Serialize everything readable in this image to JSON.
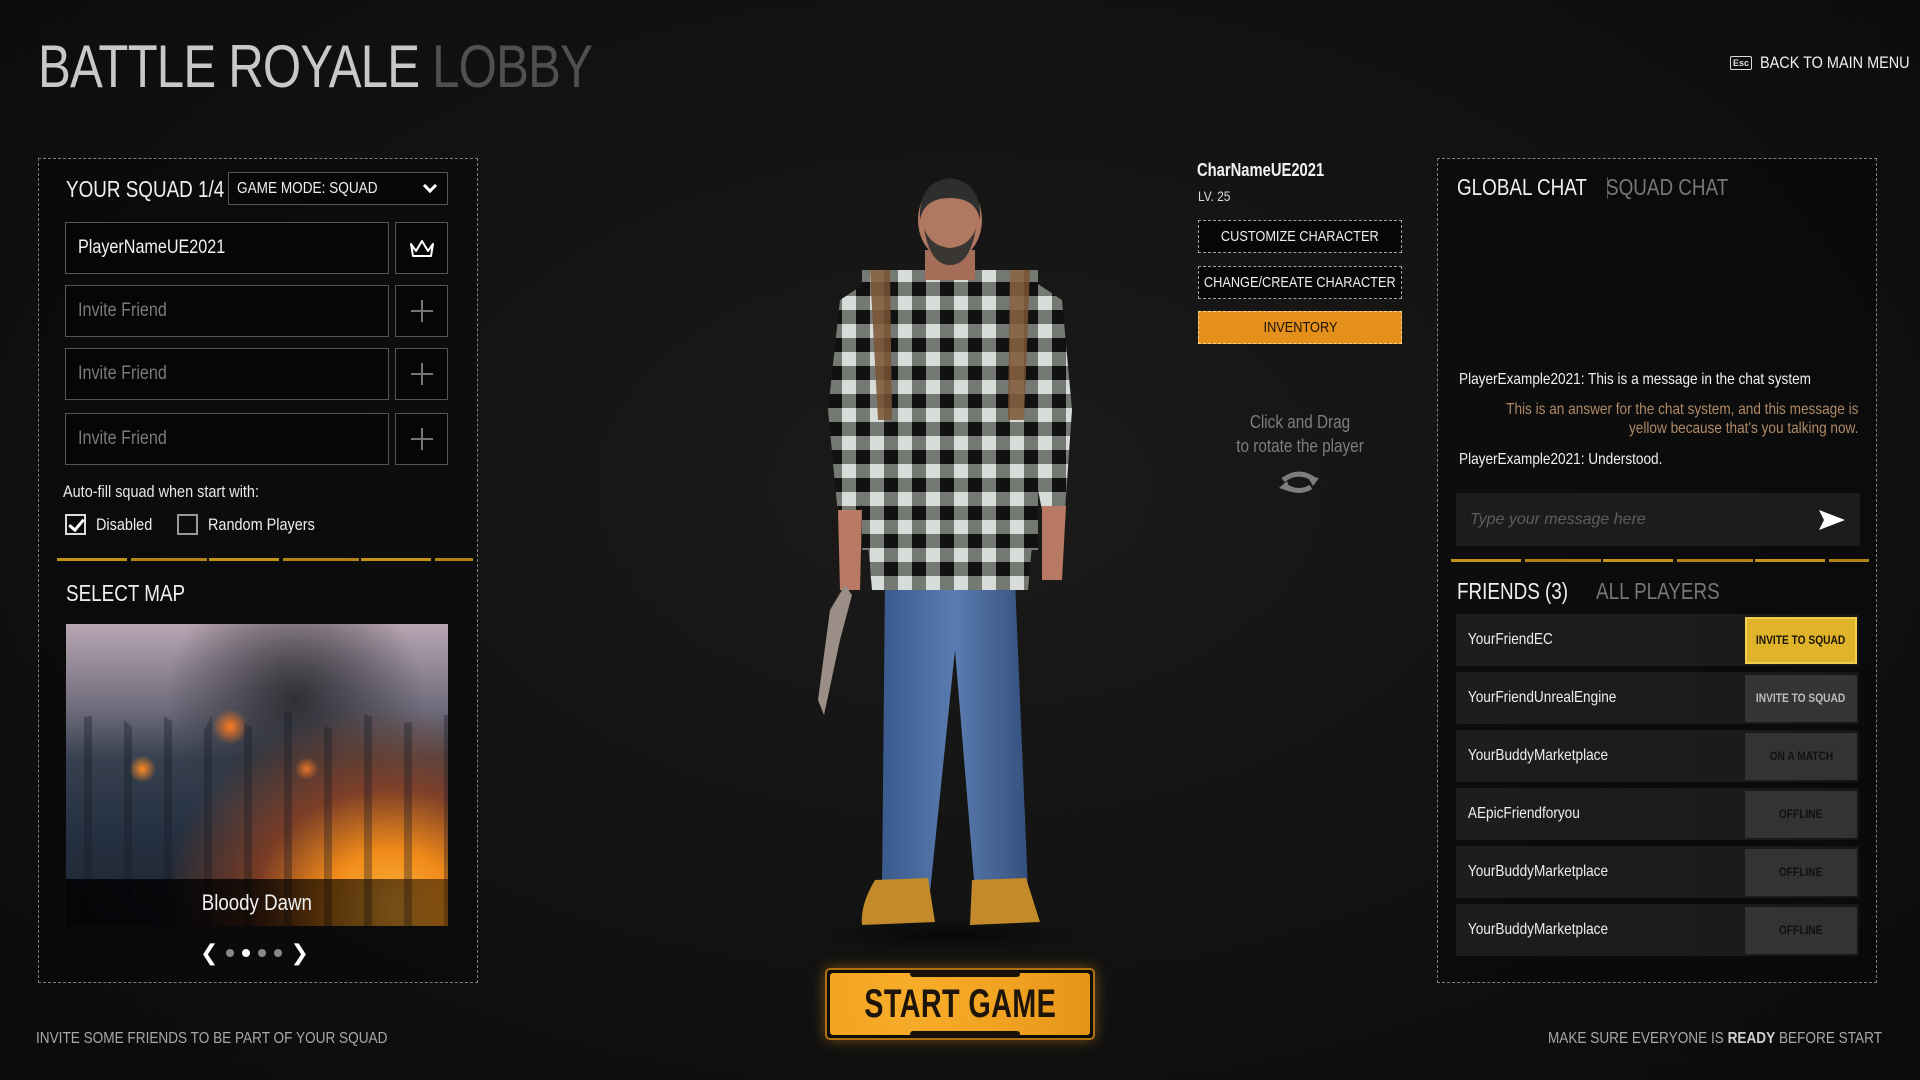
{
  "header": {
    "title_main": "BATTLE ROYALE",
    "title_sub": "LOBBY",
    "back_key": "Esc",
    "back_label": "BACK TO MAIN MENU"
  },
  "squad": {
    "title": "YOUR SQUAD 1/4",
    "game_mode": "GAME MODE: SQUAD",
    "slots": [
      {
        "value": "PlayerNameUE2021",
        "placeholder": "",
        "action_icon": "crown-icon"
      },
      {
        "value": "",
        "placeholder": "Invite Friend",
        "action_icon": "plus-icon"
      },
      {
        "value": "",
        "placeholder": "Invite Friend",
        "action_icon": "plus-icon"
      },
      {
        "value": "",
        "placeholder": "Invite Friend",
        "action_icon": "plus-icon"
      }
    ],
    "autofill_label": "Auto-fill squad when start with:",
    "autofill_options": [
      {
        "label": "Disabled",
        "checked": true
      },
      {
        "label": "Random Players",
        "checked": false
      }
    ]
  },
  "map": {
    "title": "SELECT MAP",
    "selected_name": "Bloody Dawn",
    "page_count": 4,
    "active_page": 2,
    "prev_glyph": "❮",
    "next_glyph": "❯"
  },
  "character": {
    "name": "CharNameUE2021",
    "level": "LV. 25",
    "buttons": [
      "CUSTOMIZE CHARACTER",
      "CHANGE/CREATE CHARACTER",
      "INVENTORY"
    ],
    "rotate_hint_line1": "Click and Drag",
    "rotate_hint_line2": "to rotate the player"
  },
  "chat": {
    "tabs": [
      {
        "label": "GLOBAL CHAT",
        "active": true
      },
      {
        "label": "SQUAD CHAT",
        "active": false
      }
    ],
    "messages": [
      {
        "text": "PlayerExample2021: This is a message in the chat system",
        "self": false
      },
      {
        "line1": "This is an answer for the chat system, and this message is",
        "line2": "yellow because that's you talking now.",
        "self": true
      },
      {
        "text": "PlayerExample2021: Understood.",
        "self": false
      }
    ],
    "input_placeholder": "Type your message here",
    "self_color": "#b08a66"
  },
  "friends": {
    "tabs": [
      {
        "label": "FRIENDS (3)",
        "active": true
      },
      {
        "label": "ALL PLAYERS",
        "active": false
      }
    ],
    "list": [
      {
        "name": "YourFriendEC",
        "action": "INVITE TO SQUAD",
        "state": "invite-highlighted"
      },
      {
        "name": "YourFriendUnrealEngine",
        "action": "INVITE TO SQUAD",
        "state": "invite"
      },
      {
        "name": "YourBuddyMarketplace",
        "action": "ON A MATCH",
        "state": "status"
      },
      {
        "name": "AEpicFriendforyou",
        "action": "OFFLINE",
        "state": "status"
      },
      {
        "name": "YourBuddyMarketplace",
        "action": "OFFLINE",
        "state": "status"
      },
      {
        "name": "YourBuddyMarketplace",
        "action": "OFFLINE",
        "state": "status"
      }
    ]
  },
  "start_button": "START GAME",
  "footer": {
    "left": "INVITE SOME FRIENDS TO BE PART OF YOUR SQUAD",
    "right_pre": "MAKE SURE EVERYONE IS",
    "right_bold": "READY",
    "right_post": "BEFORE START"
  },
  "colors": {
    "accent_orange": "#e5901a",
    "invite_yellow": "#e0b42a",
    "divider_yellow": "#d9a21b"
  }
}
